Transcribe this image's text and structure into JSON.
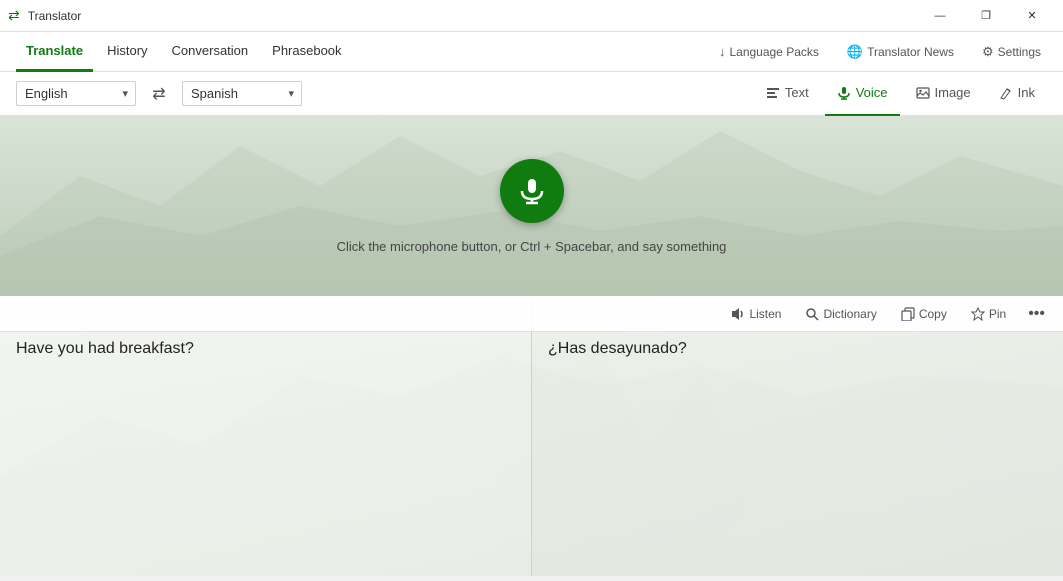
{
  "titleBar": {
    "icon": "🔄",
    "title": "Translator",
    "minimize": "—",
    "restore": "❐",
    "close": "✕"
  },
  "menuBar": {
    "items": [
      {
        "id": "translate",
        "label": "Translate",
        "active": true
      },
      {
        "id": "history",
        "label": "History",
        "active": false
      },
      {
        "id": "conversation",
        "label": "Conversation",
        "active": false
      },
      {
        "id": "phrasebook",
        "label": "Phrasebook",
        "active": false
      }
    ],
    "rightItems": [
      {
        "id": "language-packs",
        "label": "Language Packs",
        "icon": "↓"
      },
      {
        "id": "translator-news",
        "label": "Translator News",
        "icon": "🌐"
      },
      {
        "id": "settings",
        "label": "Settings",
        "icon": "⚙"
      }
    ]
  },
  "langBar": {
    "sourceLanguage": "English",
    "targetLanguage": "Spanish",
    "swapIcon": "⇄",
    "modes": [
      {
        "id": "text",
        "label": "Text",
        "icon": "T",
        "active": false
      },
      {
        "id": "voice",
        "label": "Voice",
        "icon": "🎤",
        "active": true
      },
      {
        "id": "image",
        "label": "Image",
        "icon": "🖼",
        "active": false
      },
      {
        "id": "ink",
        "label": "Ink",
        "icon": "✏",
        "active": false
      }
    ]
  },
  "voiceArea": {
    "instruction": "Click the microphone button, or Ctrl + Spacebar, and say something"
  },
  "resultArea": {
    "actions": [
      {
        "id": "listen",
        "label": "Listen",
        "icon": "🔊"
      },
      {
        "id": "dictionary",
        "label": "Dictionary",
        "icon": "🔍"
      },
      {
        "id": "copy",
        "label": "Copy",
        "icon": "📋"
      },
      {
        "id": "pin",
        "label": "Pin",
        "icon": "📌"
      }
    ],
    "moreIcon": "•••",
    "sourceText": "Have you had breakfast?",
    "translatedText": "¿Has desayunado?"
  },
  "colors": {
    "accent": "#107c10",
    "accentHover": "#0d6b0d"
  }
}
